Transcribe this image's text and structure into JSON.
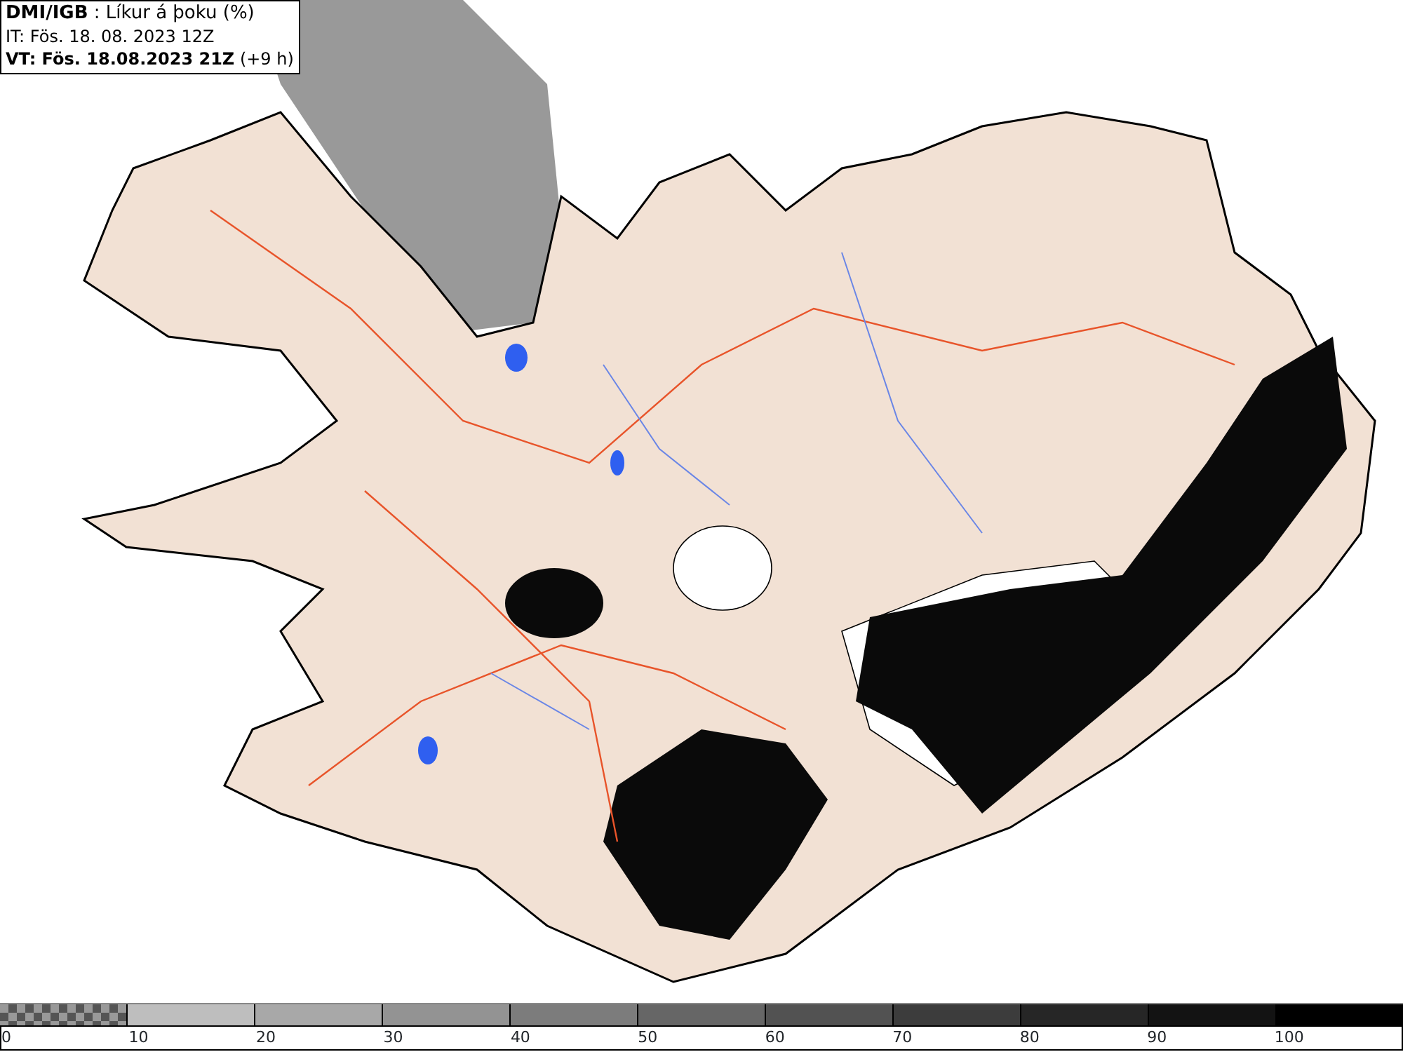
{
  "header": {
    "lines": [
      "**DMI/IGB** : Líkur á þoku (%)",
      "IT: Fös. 18. 08. 2023 12Z",
      "**VT: Fös. 18.08.2023 21Z** (+9 h)"
    ]
  },
  "legend": {
    "segments": [
      {
        "kind": "checker"
      },
      {
        "kind": "solid",
        "color": "#bebebe"
      },
      {
        "kind": "solid",
        "color": "#a8a8a8"
      },
      {
        "kind": "solid",
        "color": "#939393"
      },
      {
        "kind": "solid",
        "color": "#7c7c7c"
      },
      {
        "kind": "solid",
        "color": "#666666"
      },
      {
        "kind": "solid",
        "color": "#525252"
      },
      {
        "kind": "solid",
        "color": "#3c3c3c"
      },
      {
        "kind": "solid",
        "color": "#262626"
      },
      {
        "kind": "solid",
        "color": "#131313"
      },
      {
        "kind": "solid",
        "color": "#000000"
      }
    ],
    "ticks": [
      "0",
      "10",
      "20",
      "30",
      "40",
      "50",
      "60",
      "70",
      "80",
      "90",
      "100"
    ]
  }
}
